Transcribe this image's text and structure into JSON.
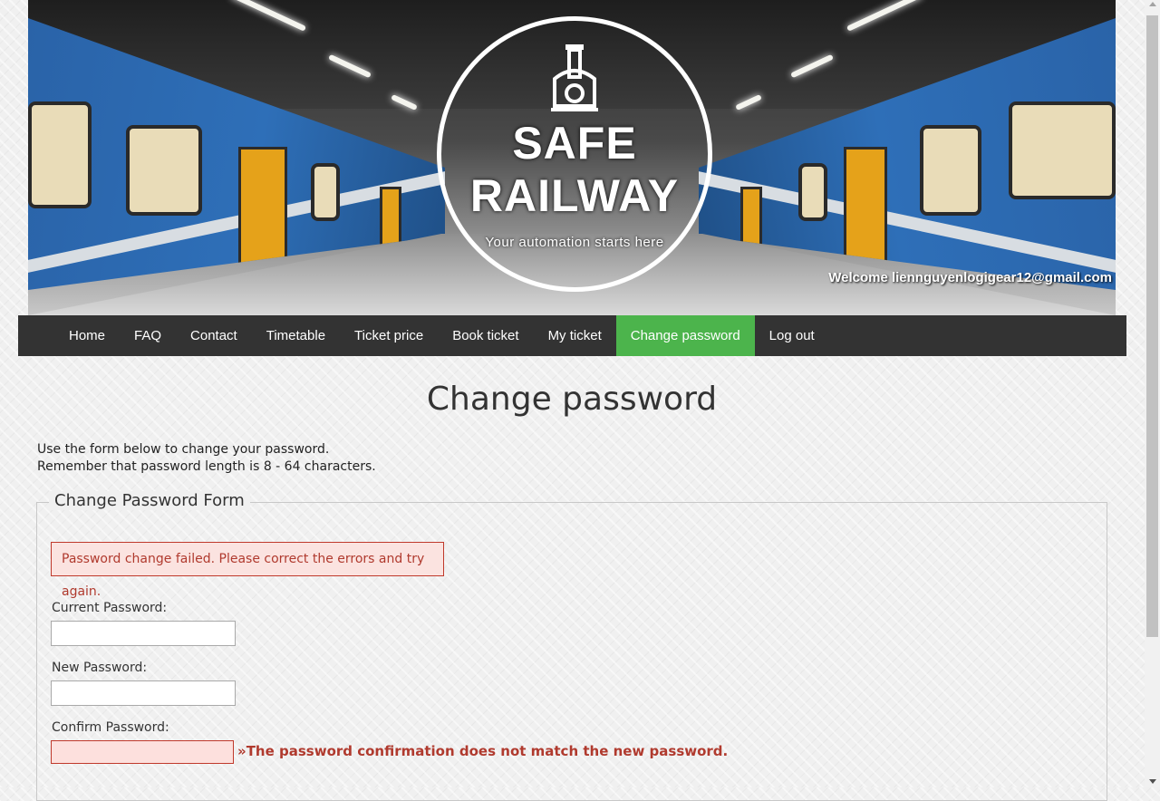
{
  "header": {
    "logo": {
      "line1": "SAFE",
      "line2": "RAILWAY",
      "tagline": "Your automation starts here",
      "icon": "train-icon"
    },
    "welcome_text": "Welcome liennguyenlogigear12@gmail.com"
  },
  "menu": {
    "items": [
      {
        "label": "Home"
      },
      {
        "label": "FAQ"
      },
      {
        "label": "Contact"
      },
      {
        "label": "Timetable"
      },
      {
        "label": "Ticket price"
      },
      {
        "label": "Book ticket"
      },
      {
        "label": "My ticket"
      },
      {
        "label": "Change password",
        "active": true
      },
      {
        "label": "Log out"
      }
    ]
  },
  "main": {
    "title": "Change password",
    "intro_line1": "Use the form below to change your password.",
    "intro_line2": "Remember that password length is 8 - 64 characters.",
    "form": {
      "legend": "Change Password Form",
      "error_message": "Password change failed. Please correct the errors and try again.",
      "current_password_label": "Current Password:",
      "current_password_value": "",
      "new_password_label": "New Password:",
      "new_password_value": "",
      "confirm_password_label": "Confirm Password:",
      "confirm_password_value": "",
      "confirm_password_error": "»The password confirmation does not match the new password."
    }
  },
  "colors": {
    "menu_background": "#333333",
    "menu_active": "#4cb44c",
    "error_text": "#b03a2e",
    "error_background": "#fbe3e0"
  }
}
